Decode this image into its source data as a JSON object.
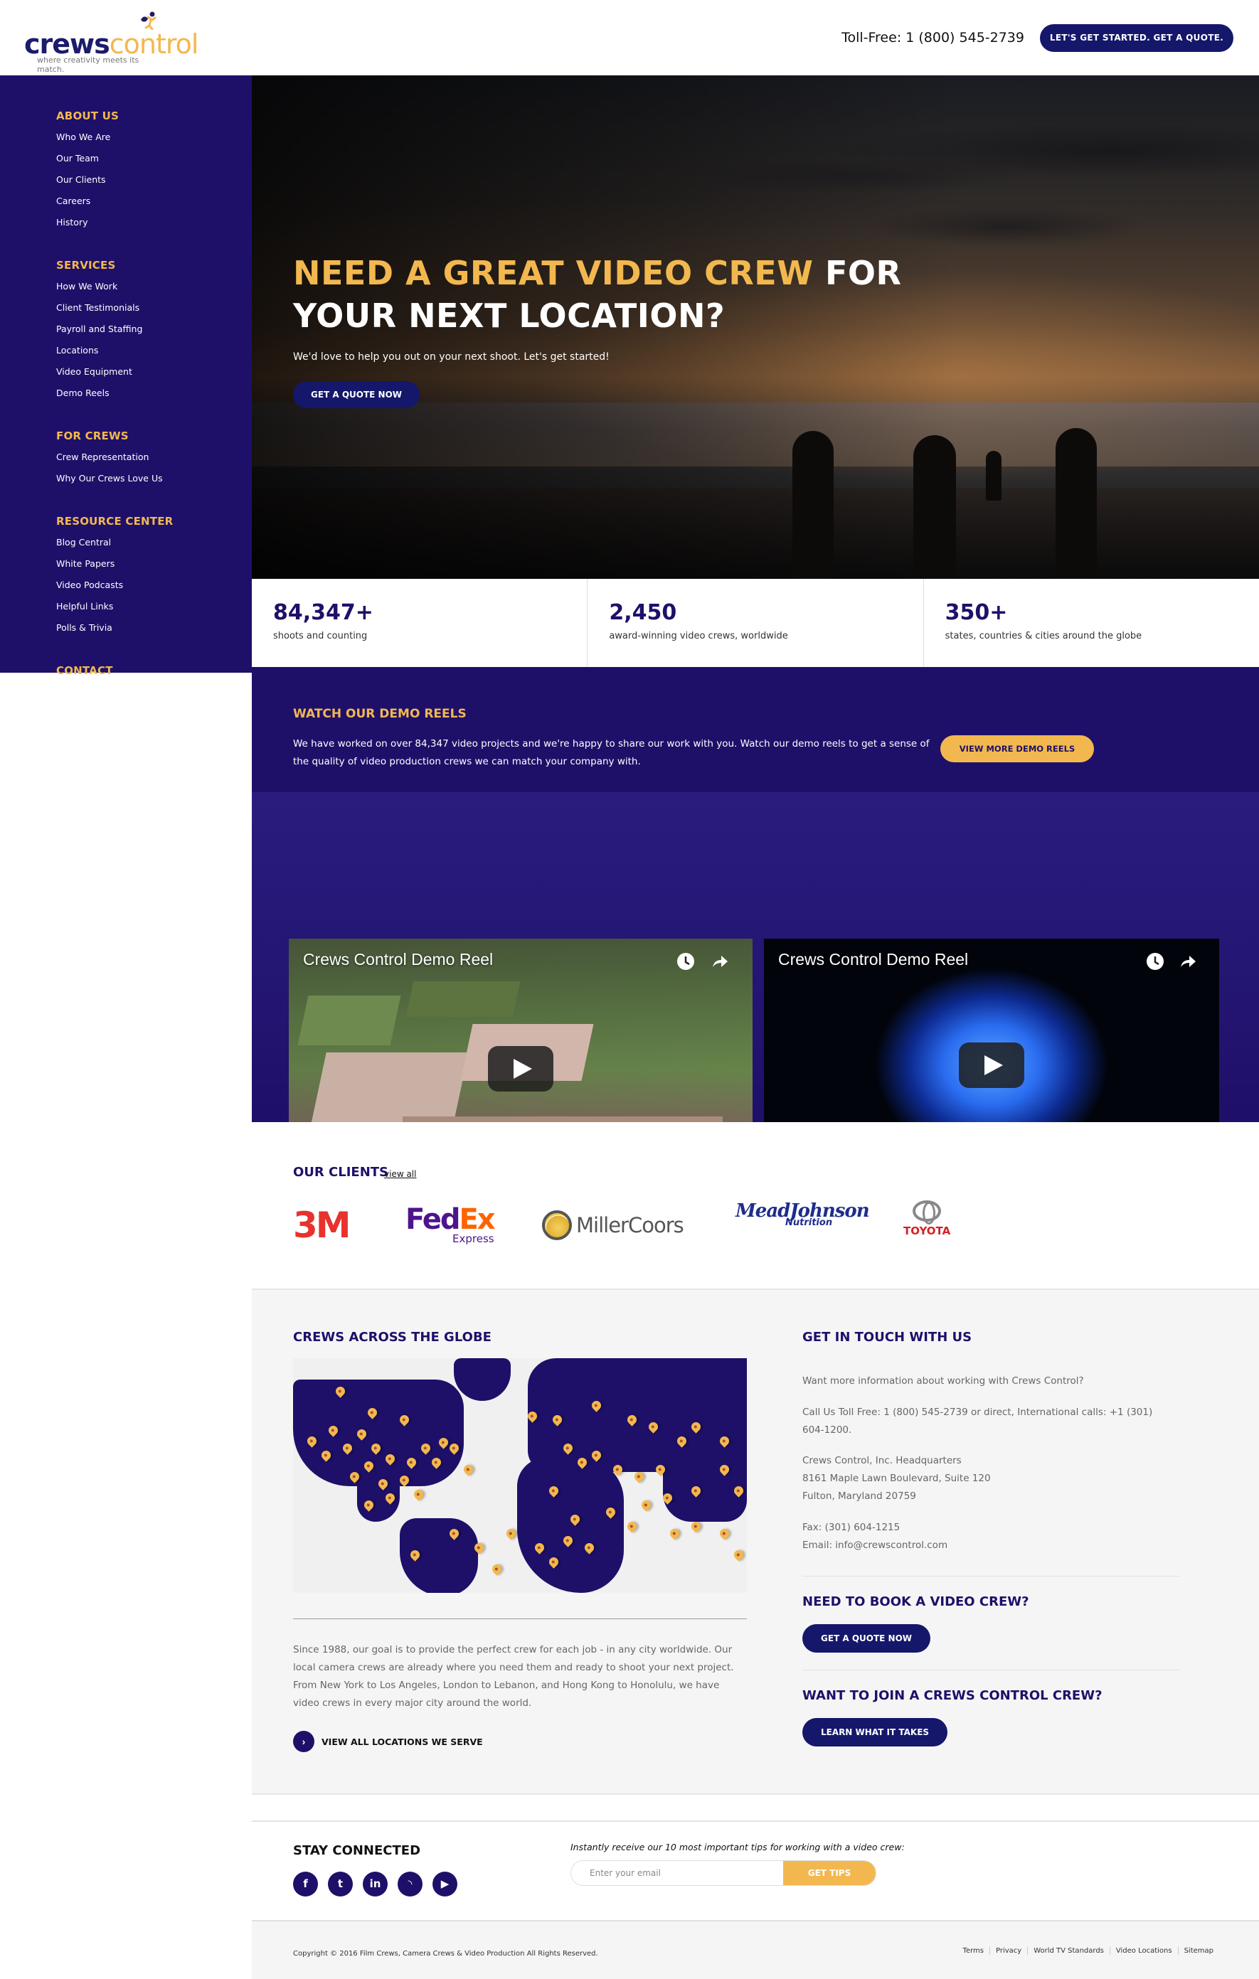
{
  "header": {
    "logo": {
      "word_a": "crews",
      "word_b": "control",
      "tagline": "where creativity meets its match."
    },
    "tollfree": "Toll-Free: 1 (800) 545-2739",
    "cta_label": "LET'S GET STARTED. GET A QUOTE."
  },
  "sidebar": {
    "groups": [
      {
        "heading": "ABOUT US",
        "items": [
          "Who We Are",
          "Our Team",
          "Our Clients",
          "Careers",
          "History"
        ]
      },
      {
        "heading": "SERVICES",
        "items": [
          "How We Work",
          "Client Testimonials",
          "Payroll and Staffing",
          "Locations",
          "Video Equipment",
          "Demo Reels"
        ]
      },
      {
        "heading": "FOR CREWS",
        "items": [
          "Crew Representation",
          "Why Our Crews Love Us"
        ]
      },
      {
        "heading": "RESOURCE CENTER",
        "items": [
          "Blog Central",
          "White Papers",
          "Video Podcasts",
          "Helpful Links",
          "Polls & Trivia"
        ]
      },
      {
        "heading": "CONTACT",
        "items": []
      }
    ]
  },
  "hero": {
    "title_highlight": "NEED A GREAT VIDEO CREW",
    "title_rest_1": " FOR",
    "title_rest_2": "YOUR NEXT LOCATION?",
    "subtitle": "We'd love to help you out on your next shoot. Let's get started!",
    "cta_label": "GET A QUOTE NOW"
  },
  "stats": [
    {
      "value": "84,347+",
      "label": "shoots and counting"
    },
    {
      "value": "2,450",
      "label": "award-winning video crews, worldwide"
    },
    {
      "value": "350+",
      "label": "states, countries & cities around the globe"
    }
  ],
  "reels": {
    "heading": "WATCH OUR DEMO REELS",
    "text": "We have worked on over 84,347 video projects and we're happy to share our work with you. Watch our demo reels to get a sense of the quality of video production crews we can match your company with.",
    "button_label": "VIEW MORE DEMO REELS",
    "videos": [
      {
        "title": "Crews Control Demo Reel"
      },
      {
        "title": "Crews Control Demo Reel"
      }
    ]
  },
  "clients": {
    "heading": "OUR CLIENTS",
    "view_all": "view all",
    "logos": {
      "threem": "3M",
      "fedex_a": "Fed",
      "fedex_b": "Ex",
      "fedex_sub": "Express",
      "miller": "MillerCoors",
      "mead": "MeadJohnson",
      "mead_sub": "Nutrition",
      "toyota": "TOYOTA"
    }
  },
  "globe": {
    "heading": "CREWS ACROSS THE GLOBE",
    "text": "Since 1988, our goal is to provide the perfect crew for each job - in any city worldwide. Our local camera crews are already where you need them and ready to shoot your next project. From New York to Los Angeles, London to Lebanon, and Hong Kong to Honolulu, we have video crews in every major city around the world.",
    "link_label": "VIEW ALL LOCATIONS WE SERVE"
  },
  "contact": {
    "heading": "GET IN TOUCH WITH US",
    "intro": "Want more information about working with Crews Control?",
    "phone": "Call Us Toll Free: 1 (800) 545-2739 or direct, International calls: +1 (301) 604-1200.",
    "hq_name": "Crews Control, Inc. Headquarters",
    "hq_street": "8161 Maple Lawn Boulevard, Suite 120",
    "hq_city": "Fulton, Maryland 20759",
    "fax": "Fax: (301) 604-1215",
    "email": "Email: info@crewscontrol.com",
    "book_heading": "NEED TO BOOK A VIDEO CREW?",
    "book_button": "GET A QUOTE NOW",
    "join_heading": "WANT TO JOIN A CREWS CONTROL CREW?",
    "join_button": "LEARN WHAT IT TAKES"
  },
  "stay": {
    "heading": "STAY CONNECTED",
    "social": [
      {
        "name": "facebook",
        "glyph": "f"
      },
      {
        "name": "twitter",
        "glyph": "t"
      },
      {
        "name": "linkedin",
        "glyph": "in"
      },
      {
        "name": "rss",
        "glyph": "◝"
      },
      {
        "name": "youtube",
        "glyph": "▶"
      }
    ],
    "tips_label": "Instantly receive our 10 most important tips for working with a video crew:",
    "email_placeholder": "Enter your email",
    "email_value": "",
    "tips_button": "GET TIPS"
  },
  "footer": {
    "copyright": "Copyright © 2016 Film Crews, Camera Crews & Video Production All Rights Reserved.",
    "links": [
      "Terms",
      "Privacy",
      "World TV Standards",
      "Video Locations",
      "Sitemap"
    ]
  },
  "colors": {
    "navy": "#1e1069",
    "button_navy": "#14176a",
    "gold": "#f2b84f",
    "light_gray": "#f5f5f5"
  }
}
